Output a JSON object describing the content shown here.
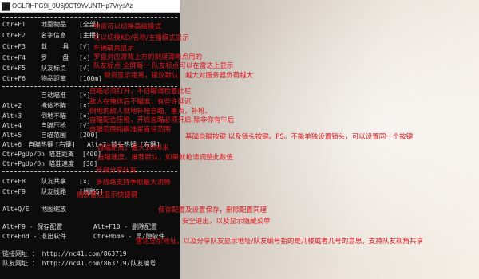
{
  "window": {
    "title": "OGLRHFG9l_0U6j9CT9YvUNTHp7VrysAz",
    "separator_top": "------------------------------",
    "separator_mid": "------------------------------"
  },
  "hotkeys": [
    {
      "key": "Ctr+F1",
      "label": "地面物品",
      "value": "[全部]",
      "note": "物资可以切换高级模式"
    },
    {
      "key": "Ctr+F2",
      "label": "名字信息",
      "value": "[主播]",
      "note": "可以切换KD/名称/主播模式显示"
    },
    {
      "key": "Ctr+F3",
      "label": "载    具",
      "value": "[√]",
      "note": "车辆载具显示"
    },
    {
      "key": "Ctr+F4",
      "label": "罗    盘",
      "value": "[×]",
      "note": "罗盘对应游戏上方的刻度清晰点用的"
    },
    {
      "key": "Ctr+F5",
      "label": "队友标点",
      "value": "[√]",
      "note": "队友标点 全屏每一 队友标点可以在雷达上显示"
    },
    {
      "key": "Ctr+F6",
      "label": "物品距离",
      "value": "[100m]",
      "note": "物资显示距离，建议默认，越大对服务器负荷越大"
    }
  ],
  "aim": [
    {
      "key": "",
      "label": "自动瞄准",
      "value": "[×]",
      "note": "自瞄必须打开，不自瞄请检查此栏"
    },
    {
      "key": "Alt+2",
      "label": "掩体不瞄",
      "value": "[×]",
      "note": "敌人在掩体后不瞄准，有些许延迟"
    },
    {
      "key": "Alt+3",
      "label": "倒地不瞄",
      "value": "[×]",
      "note": "倒地的敌人就地补枪自瞄，重点，补枪。"
    },
    {
      "key": "Alt+4",
      "label": "自瞄压枪",
      "value": "[√]",
      "note": "自瞄配合压枪，开启自瞄必须开启 除非你有午后"
    },
    {
      "key": "Alt+5",
      "label": "自瞄范围",
      "value": "[200]",
      "note": "自瞄范围指瞬准星直径范围"
    }
  ],
  "aim_hotkeys": {
    "key": "Alt+6",
    "label1": "自瞄热键",
    "value1": "[右键]",
    "key2": "Alt+7",
    "label2": "锁头热键",
    "value2": "[右键]",
    "note": "基础自瞄按键 以及锁头按键。PS。不能单独设置锁头，可以设置同一个按键"
  },
  "aim_tuning": [
    {
      "key": "Ctr+PgUp/Dn",
      "label": "瞄准距离",
      "value": "[400]",
      "note": "自瞄距离，最大1000米"
    },
    {
      "key": "Ctr+PgUp/Dn",
      "label": "瞄准速度",
      "value": "[30]",
      "note": "自瞄速度，推荐默认，如果就枪请调整此数值"
    }
  ],
  "team": [
    {
      "key": "Ctr+F8",
      "label": "队友共享",
      "value": "[×]",
      "note": "开启分享队友"
    },
    {
      "key": "Ctr+F9",
      "label": "队友线路",
      "value": "[线路5]",
      "note": "多线路支持争取最大流畅"
    }
  ],
  "radar": {
    "key": "Alt+Q/E",
    "label": "地图缩放",
    "note": "缩放雷达显示快捷键"
  },
  "config": {
    "line1": "Alt+F9 - 保存配置        Alt+F10 - 删除配置",
    "line2": "Ctr+End - 退出软件       Ctr+Home - 显/隐软件",
    "note1": "保存配置及设置保存，删除配置同理",
    "note2": "安全退出，以及显示隐藏菜单"
  },
  "links": {
    "line1": "链接网址 ： http://nc41.com/863719",
    "line2": "队友网址 ： http://nc41.com/863719/队友编号",
    "note": "雷达显示地址，以及分享队友显示地址/队友编号指的是几楼或者几号的意思，支持队友视角共享"
  }
}
